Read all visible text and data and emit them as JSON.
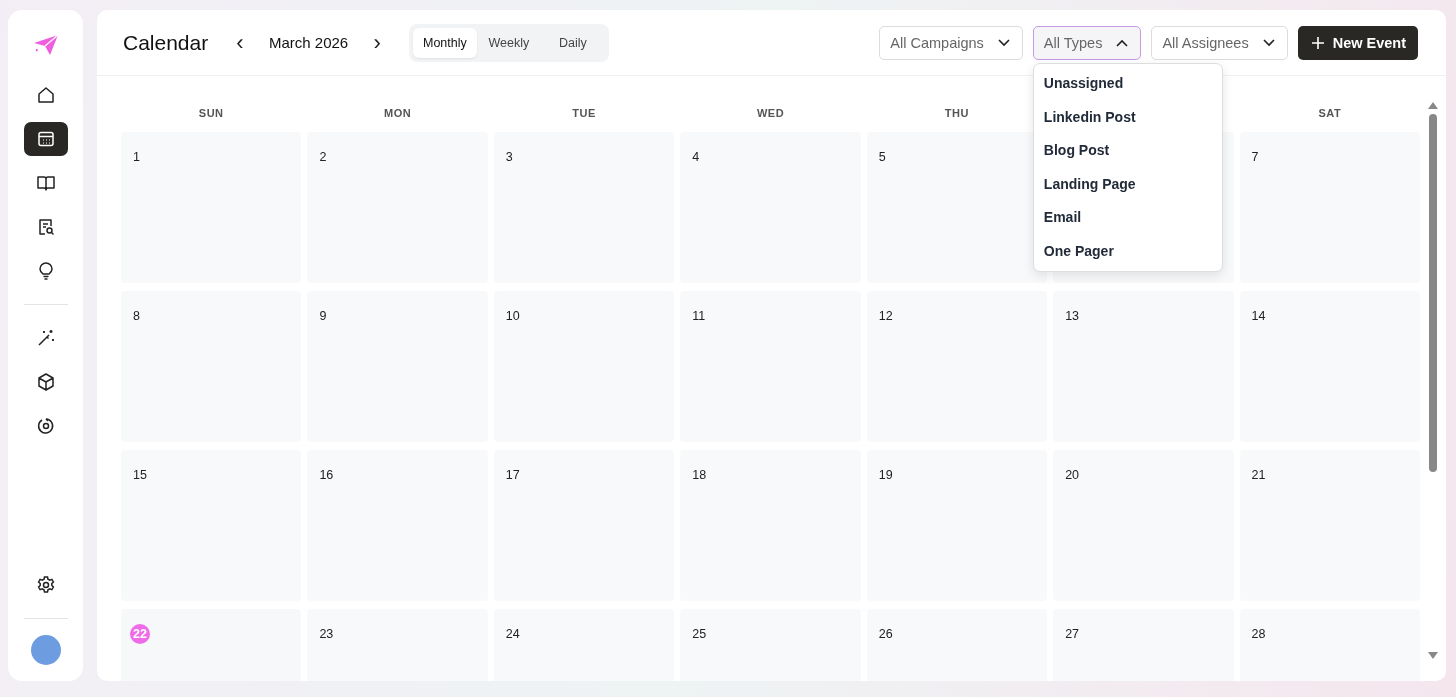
{
  "sidebar": {
    "nav_top": [
      {
        "selected": false
      },
      {
        "selected": true
      },
      {
        "selected": false
      },
      {
        "selected": false
      },
      {
        "selected": false
      }
    ],
    "nav_tools": [
      {
        "selected": false
      },
      {
        "selected": false
      },
      {
        "selected": false
      }
    ]
  },
  "header": {
    "title": "Calendar",
    "prev": "‹",
    "period": "March 2026",
    "next": "›",
    "view_tabs": [
      {
        "label": "Monthly",
        "selected": true
      },
      {
        "label": "Weekly",
        "selected": false
      },
      {
        "label": "Daily",
        "selected": false
      }
    ],
    "filters": [
      {
        "label": "All Campaigns",
        "expanded": false
      },
      {
        "label": "All Types",
        "expanded": true
      },
      {
        "label": "All Assignees",
        "expanded": false
      }
    ],
    "new_button": "New Event"
  },
  "type_menu": [
    "Unassigned",
    "Linkedin Post",
    "Blog Post",
    "Landing Page",
    "Email",
    "One Pager"
  ],
  "weekdays_before_menu": [
    "SUN",
    "MON",
    "TUE",
    "WED",
    "THU"
  ],
  "weekdays_after_menu": [
    "SAT"
  ],
  "weeks": [
    [
      {
        "day": "1",
        "today": false
      },
      {
        "day": "2",
        "today": false
      },
      {
        "day": "3",
        "today": false
      },
      {
        "day": "4",
        "today": false
      },
      {
        "day": "5",
        "today": false
      },
      {
        "today": false
      },
      {
        "day": "7",
        "today": false
      }
    ],
    [
      {
        "day": "8",
        "today": false
      },
      {
        "day": "9",
        "today": false
      },
      {
        "day": "10",
        "today": false
      },
      {
        "day": "11",
        "today": false
      },
      {
        "day": "12",
        "today": false
      },
      {
        "day": "13",
        "today": false
      },
      {
        "day": "14",
        "today": false
      }
    ],
    [
      {
        "day": "15",
        "today": false
      },
      {
        "day": "16",
        "today": false
      },
      {
        "day": "17",
        "today": false
      },
      {
        "day": "18",
        "today": false
      },
      {
        "day": "19",
        "today": false
      },
      {
        "day": "20",
        "today": false
      },
      {
        "day": "21",
        "today": false
      }
    ],
    [
      {
        "day": "22",
        "today": true
      },
      {
        "day": "23",
        "today": false
      },
      {
        "day": "24",
        "today": false
      },
      {
        "day": "25",
        "today": false
      },
      {
        "day": "26",
        "today": false
      },
      {
        "day": "27",
        "today": false
      },
      {
        "day": "28",
        "today": false
      }
    ]
  ]
}
